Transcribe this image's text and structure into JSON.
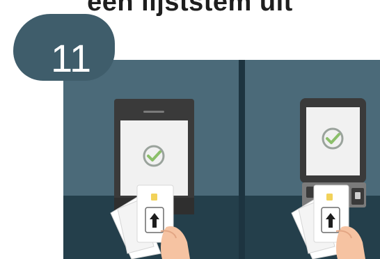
{
  "heading": "een lijststem uit",
  "step_number": "11",
  "colors": {
    "wall": "#4b6a79",
    "floor": "#243f4b",
    "divider": "#1d3440",
    "machine": "#3a3a3a",
    "screen": "#f1f1f1",
    "check": "#8bbf6a",
    "card": "#ffffff",
    "hand": "#f6c3a2",
    "badge": "#3f5d6b"
  },
  "icons": [
    "check-circle-icon",
    "arrow-up-icon",
    "chip-icon"
  ]
}
